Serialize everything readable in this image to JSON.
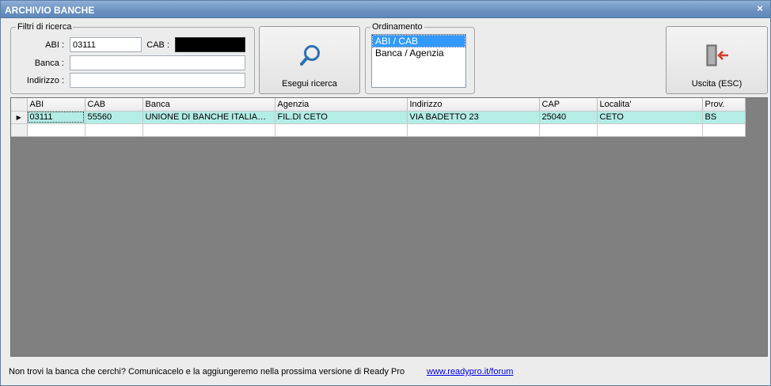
{
  "window": {
    "title": "ARCHIVIO BANCHE",
    "close_glyph": "×"
  },
  "filters": {
    "legend": "Filtri di ricerca",
    "abi_label": "ABI :",
    "abi_value": "03111",
    "cab_label": "CAB :",
    "cab_value": "",
    "banca_label": "Banca :",
    "banca_value": "",
    "indirizzo_label": "Indirizzo :",
    "indirizzo_value": ""
  },
  "search_button": {
    "label": "Esegui ricerca",
    "icon": "magnifier-icon"
  },
  "ordering": {
    "legend": "Ordinamento",
    "options": [
      "ABI / CAB",
      "Banca / Agenzia"
    ],
    "selected": "ABI / CAB"
  },
  "exit_button": {
    "label": "Uscita (ESC)",
    "icon": "exit-door-icon"
  },
  "grid": {
    "columns": [
      "ABI",
      "CAB",
      "Banca",
      "Agenzia",
      "Indirizzo",
      "CAP",
      "Localita'",
      "Prov."
    ],
    "rows": [
      [
        "03111",
        "55560",
        "UNIONE DI BANCHE ITALIANE SOCIETA' COOPERATIVA PER AZIONI",
        "FIL.DI CETO",
        "VIA BADETTO 23",
        "25040",
        "CETO",
        "BS"
      ]
    ],
    "current_row_indicator": "▶"
  },
  "footer": {
    "message": "Non trovi la banca che cerchi? Comunicacelo e la aggiungeremo nella prossima versione di Ready Pro",
    "link": "www.readypro.it/forum"
  },
  "colors": {
    "titlebar": "#6d93c2",
    "selected_row": "#b4ece6",
    "listbox_selection": "#3399ff",
    "grid_background": "#808080",
    "link": "#0000ee"
  }
}
